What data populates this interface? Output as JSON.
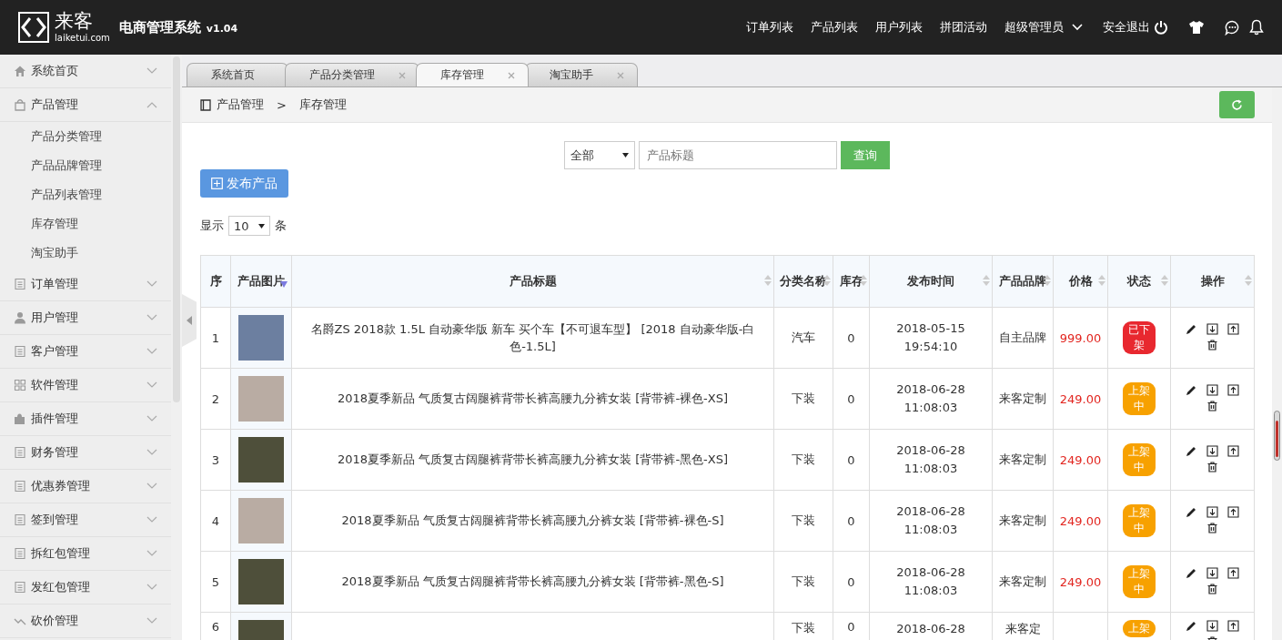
{
  "header": {
    "logo_text": "来客",
    "logo_sub": "laiketui.com",
    "title": "电商管理系统",
    "version": "v1.04",
    "nav": [
      "订单列表",
      "产品列表",
      "用户列表",
      "拼团活动"
    ],
    "user": "超级管理员",
    "logout": "安全退出"
  },
  "sidebar": {
    "items": [
      {
        "label": "系统首页",
        "expanded": false
      },
      {
        "label": "产品管理",
        "expanded": true,
        "children": [
          {
            "label": "产品分类管理"
          },
          {
            "label": "产品品牌管理"
          },
          {
            "label": "产品列表管理"
          },
          {
            "label": "库存管理"
          },
          {
            "label": "淘宝助手"
          }
        ]
      },
      {
        "label": "订单管理",
        "expanded": false
      },
      {
        "label": "用户管理",
        "expanded": false
      },
      {
        "label": "客户管理",
        "expanded": false
      },
      {
        "label": "软件管理",
        "expanded": false
      },
      {
        "label": "插件管理",
        "expanded": false
      },
      {
        "label": "财务管理",
        "expanded": false
      },
      {
        "label": "优惠券管理",
        "expanded": false
      },
      {
        "label": "签到管理",
        "expanded": false
      },
      {
        "label": "拆红包管理",
        "expanded": false
      },
      {
        "label": "发红包管理",
        "expanded": false
      },
      {
        "label": "砍价管理",
        "expanded": false
      }
    ]
  },
  "tabs": [
    {
      "label": "系统首页",
      "selected": false,
      "closable": false
    },
    {
      "label": "产品分类管理",
      "selected": false,
      "closable": true
    },
    {
      "label": "库存管理",
      "selected": true,
      "closable": true
    },
    {
      "label": "淘宝助手",
      "selected": false,
      "closable": true
    }
  ],
  "breadcrumb": {
    "items": [
      "产品管理",
      "库存管理"
    ],
    "separator": ">"
  },
  "filter": {
    "select": "全部",
    "placeholder": "产品标题",
    "button": "查询"
  },
  "publish_button": "发布产品",
  "page_size": {
    "prefix": "显示",
    "value": "10",
    "suffix": "条"
  },
  "table": {
    "columns": [
      "序",
      "产品图片",
      "产品标题",
      "分类名称",
      "库存",
      "发布时间",
      "产品品牌",
      "价格",
      "状态",
      "操作"
    ],
    "rows": [
      {
        "no": "1",
        "title": "名爵ZS 2018款 1.5L 自动豪华版 新车 买个车【不可退车型】  [2018 自动豪华版-白色-1.5L]",
        "category": "汽车",
        "stock": "0",
        "time": "2018-05-15 19:54:10",
        "brand": "自主品牌",
        "price": "999.00",
        "status": "已下架",
        "kind": "off"
      },
      {
        "no": "2",
        "title": "2018夏季新品 气质复古阔腿裤背带长裤高腰九分裤女装  [背带裤-裸色-XS]",
        "category": "下装",
        "stock": "0",
        "time": "2018-06-28 11:08:03",
        "brand": "来客定制",
        "price": "249.00",
        "status": "上架中",
        "kind": "on"
      },
      {
        "no": "3",
        "title": "2018夏季新品 气质复古阔腿裤背带长裤高腰九分裤女装  [背带裤-黑色-XS]",
        "category": "下装",
        "stock": "0",
        "time": "2018-06-28 11:08:03",
        "brand": "来客定制",
        "price": "249.00",
        "status": "上架中",
        "kind": "on"
      },
      {
        "no": "4",
        "title": "2018夏季新品 气质复古阔腿裤背带长裤高腰九分裤女装  [背带裤-裸色-S]",
        "category": "下装",
        "stock": "0",
        "time": "2018-06-28 11:08:03",
        "brand": "来客定制",
        "price": "249.00",
        "status": "上架中",
        "kind": "on"
      },
      {
        "no": "5",
        "title": "2018夏季新品 气质复古阔腿裤背带长裤高腰九分裤女装  [背带裤-黑色-S]",
        "category": "下装",
        "stock": "0",
        "time": "2018-06-28 11:08:03",
        "brand": "来客定制",
        "price": "249.00",
        "status": "上架中",
        "kind": "on"
      },
      {
        "no": "6",
        "category": "下装",
        "stock": "0",
        "time": "2018-06-28",
        "brand": "来客定",
        "status": "上架",
        "kind": "on"
      }
    ]
  }
}
